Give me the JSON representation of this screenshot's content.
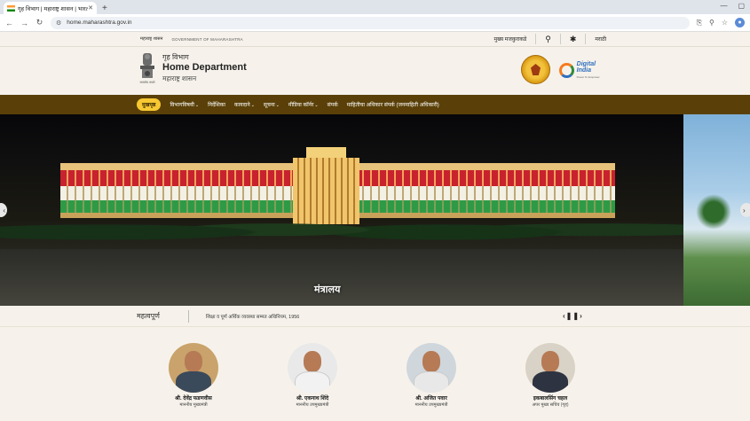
{
  "browser": {
    "tab_title": "गृह विभाग | महाराष्ट्र शासन | भारत",
    "url": "home.maharashtra.gov.in"
  },
  "topstrip": {
    "gov_mr": "महाराष्ट्र शासन",
    "gov_en": "GOVERNMENT OF MAHARASHTRA",
    "main_content": "मुख्य मजकुराकडे",
    "lang": "मराठी"
  },
  "header": {
    "dept_mr": "गृह विभाग",
    "dept_en": "Home Department",
    "gov_mr": "महाराष्ट्र शासन",
    "emblem_caption": "सत्यमेव जयते",
    "digital_india": "Digital India",
    "digital_india_sub": "Power To Empower"
  },
  "nav": {
    "items": [
      {
        "label": "मुखपृष्ठ",
        "has_menu": false
      },
      {
        "label": "विभागविषयी",
        "has_menu": true
      },
      {
        "label": "निर्देशिका",
        "has_menu": false
      },
      {
        "label": "कायदाने",
        "has_menu": true
      },
      {
        "label": "सूचना",
        "has_menu": true
      },
      {
        "label": "मीडिया कॉर्नर",
        "has_menu": true
      },
      {
        "label": "संपर्क",
        "has_menu": false
      },
      {
        "label": "माहितीचा अधिकार संपर्क (जनमाहिती अधिकारी)",
        "has_menu": false
      }
    ]
  },
  "hero": {
    "caption": "मंत्रालय"
  },
  "ticker": {
    "label": "महत्वपूर्ण",
    "text": "शिक्षा व पूर्ण अर्थिक व्यवस्था सम्मत अधिनियम, 1956"
  },
  "leaders": [
    {
      "name": "श्री. देवेंद्र फडणवीस",
      "role": "माननीय मुख्यमंत्री",
      "color": "#3b4a5a"
    },
    {
      "name": "श्री. एकनाथ शिंदे",
      "role": "माननीय उपमुख्यमंत्री",
      "color": "#f2f2f2"
    },
    {
      "name": "श्री. अजित पवार",
      "role": "माननीय उपमुख्यमंत्री",
      "color": "#e8e8e8"
    },
    {
      "name": "इकबालसिंग चहल",
      "role": "अपर मुख्य सचिव (गृह)",
      "color": "#2d3340"
    }
  ]
}
